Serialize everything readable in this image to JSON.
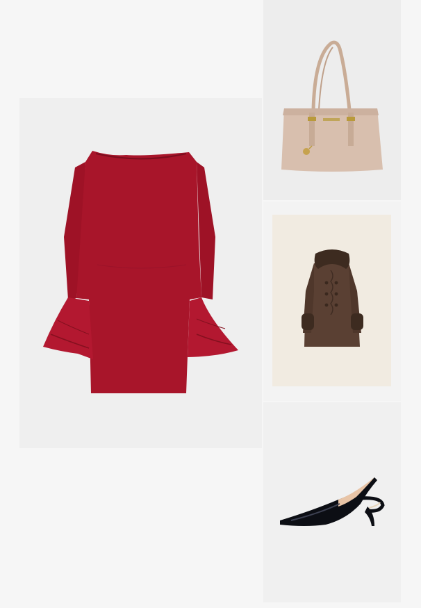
{
  "outfit": {
    "items": [
      {
        "id": "dress",
        "label": ""
      },
      {
        "id": "handbag",
        "label": ""
      },
      {
        "id": "coat",
        "label": ""
      },
      {
        "id": "shoes",
        "label": ""
      }
    ]
  },
  "colors": {
    "background": "#f6f6f6",
    "dress": "#a8152a",
    "handbag": "#d8bfae",
    "coat": "#5a4033",
    "coat_fur": "#3d2b20",
    "shoes": "#0c0e14",
    "coat_backdrop": "#f1ebe1"
  },
  "icons": [
    "dress-image",
    "handbag-image",
    "coat-image",
    "shoes-image"
  ]
}
